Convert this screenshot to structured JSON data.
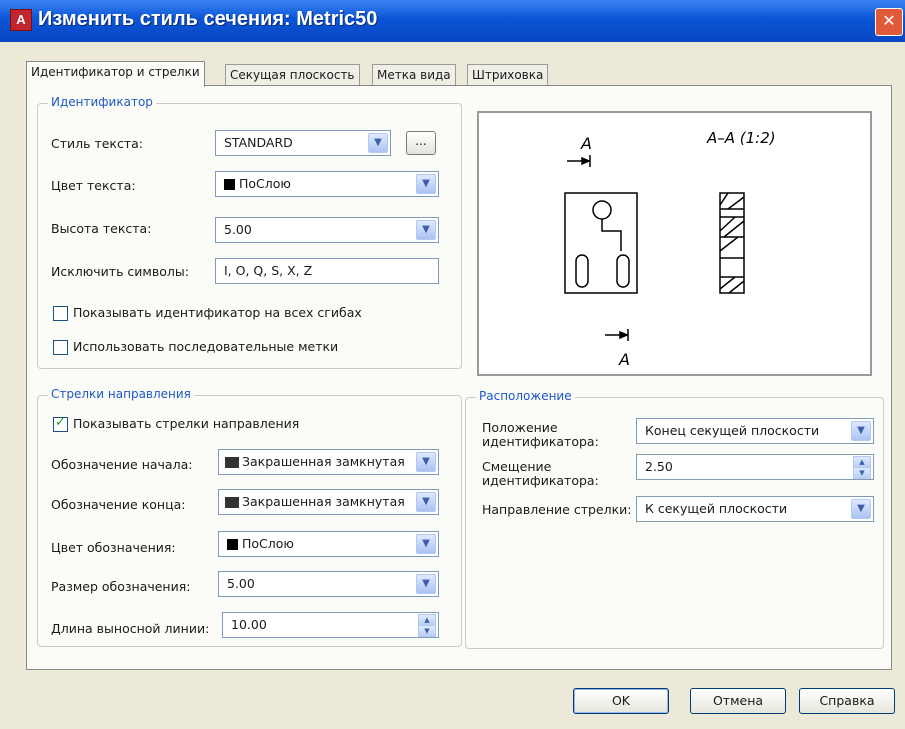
{
  "window": {
    "title": "Изменить стиль сечения: Metric50",
    "app_icon_letter": "A",
    "close_glyph": "✕"
  },
  "tabs": [
    {
      "label": "Идентификатор и стрелки",
      "active": true
    },
    {
      "label": "Секущая плоскость",
      "active": false
    },
    {
      "label": "Метка вида",
      "active": false
    },
    {
      "label": "Штриховка",
      "active": false
    }
  ],
  "identifier": {
    "group_label": "Идентификатор",
    "text_style": {
      "label": "Стиль текста:",
      "value": "STANDARD",
      "more_button": "..."
    },
    "text_color": {
      "label": "Цвет текста:",
      "value": "ПоСлою"
    },
    "text_height": {
      "label": "Высота текста:",
      "value": "5.00"
    },
    "exclude_chars": {
      "label": "Исключить символы:",
      "value": "I, O, Q, S, X, Z"
    },
    "show_all_bends": {
      "label": "Показывать идентификатор на всех сгибах",
      "checked": false
    },
    "consecutive_labels": {
      "label": "Использовать последовательные метки",
      "checked": false
    }
  },
  "arrows": {
    "group_label": "Стрелки направления",
    "show_arrows": {
      "label": "Показывать стрелки направления",
      "checked": true
    },
    "start_symbol": {
      "label": "Обозначение начала:",
      "value": "Закрашенная замкнутая"
    },
    "end_symbol": {
      "label": "Обозначение конца:",
      "value": "Закрашенная замкнутая"
    },
    "symbol_color": {
      "label": "Цвет обозначения:",
      "value": "ПоСлою"
    },
    "symbol_size": {
      "label": "Размер обозначения:",
      "value": "5.00"
    },
    "extension_length": {
      "label": "Длина выносной линии:",
      "value": "10.00"
    }
  },
  "location": {
    "group_label": "Расположение",
    "identifier_position": {
      "label_line1": "Положение",
      "label_line2": "идентификатора:",
      "value": "Конец секущей плоскости"
    },
    "identifier_offset": {
      "label_line1": "Смещение",
      "label_line2": "идентификатора:",
      "value": "2.50"
    },
    "arrow_direction": {
      "label": "Направление стрелки:",
      "value": "К секущей плоскости"
    }
  },
  "preview": {
    "top_letter": "A",
    "bottom_letter": "A",
    "section_label": "A–A (1:2)"
  },
  "buttons": {
    "ok": "OK",
    "cancel": "Отмена",
    "help": "Справка"
  },
  "colors": {
    "title_bar": "#0a55d6",
    "group_label": "#1f58c8",
    "dialog_bg": "#ece9d8"
  }
}
